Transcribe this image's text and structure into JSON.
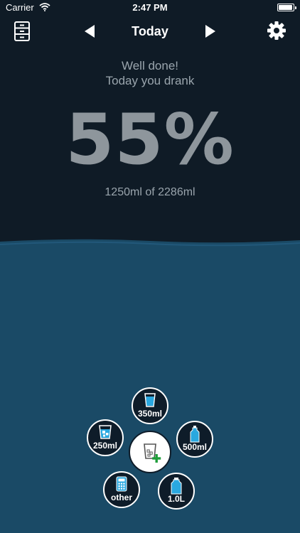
{
  "status_bar": {
    "carrier": "Carrier",
    "time": "2:47 PM",
    "battery_level": 0.95
  },
  "nav": {
    "title": "Today"
  },
  "summary": {
    "line1": "Well done!",
    "line2": "Today you drank",
    "percent": "55%",
    "amount": "1250ml of 2286ml",
    "progress": 0.55
  },
  "drinks": [
    {
      "label": "350ml",
      "icon": "glass-icon"
    },
    {
      "label": "250ml",
      "icon": "glass-ice-icon"
    },
    {
      "label": "500ml",
      "icon": "bottle-icon"
    },
    {
      "label": "other",
      "icon": "calculator-icon"
    },
    {
      "label": "1.0L",
      "icon": "large-bottle-icon"
    }
  ],
  "colors": {
    "background": "#0f1b26",
    "water": "#1a4a66",
    "accent": "#2aa8e0",
    "plus": "#1e9e3a"
  }
}
